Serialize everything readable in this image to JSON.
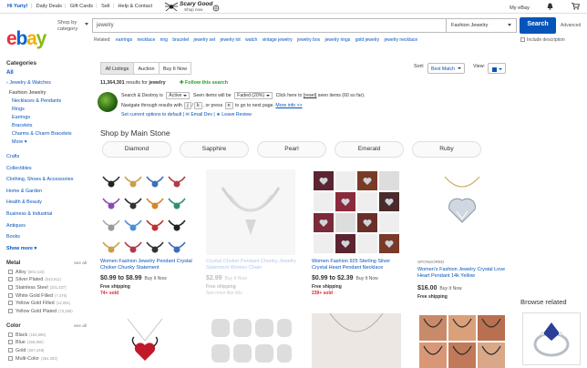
{
  "topbar": {
    "greeting": "Hi Yuriy!",
    "links": [
      "Daily Deals",
      "Gift Cards",
      "Sell",
      "Help & Contact"
    ],
    "promo_line1": "Scary Good",
    "promo_line2": "Shop now",
    "my_ebay": "My eBay",
    "icons": [
      "bell-icon",
      "cart-icon"
    ]
  },
  "header": {
    "logo_letters": [
      "e",
      "b",
      "a",
      "y"
    ],
    "logo_colors": [
      "#e53238",
      "#0064d2",
      "#f5af02",
      "#86b817"
    ],
    "shop_by_category": "Shop by category",
    "search_value": "jewelry",
    "category_value": "Fashion Jewelry",
    "search_button": "Search",
    "advanced": "Advanced",
    "related_label": "Related:",
    "related": [
      "earrings",
      "necklace",
      "ring",
      "bracelet",
      "jewelry set",
      "jewelry lot",
      "watch",
      "vintage jewelry",
      "jewelry box",
      "jewelry rings",
      "gold jewelry",
      "jewelry necklace"
    ],
    "include_description": "Include description"
  },
  "sidebar": {
    "heading": "Categories",
    "all": "All",
    "crumb": "‹ Jewelry & Watches",
    "current": "Fashion Jewelry",
    "subs": [
      "Necklaces & Pendants",
      "Rings",
      "Earrings",
      "Bracelets",
      "Charms & Charm Bracelets"
    ],
    "subs_more": "More ▾",
    "top_cats": [
      "Crafts",
      "Collectibles",
      "Clothing, Shoes & Accessories",
      "Home & Garden",
      "Health & Beauty",
      "Business & Industrial",
      "Antiques",
      "Books"
    ],
    "show_more": "Show more ▾",
    "facets": [
      {
        "title": "Metal",
        "see_all": "see all",
        "options": [
          {
            "label": "Alloy",
            "count": "(604,143)"
          },
          {
            "label": "Silver Plated",
            "count": "(543,911)"
          },
          {
            "label": "Stainless Steel",
            "count": "(201,437)"
          },
          {
            "label": "White Gold Filled",
            "count": "(7,476)"
          },
          {
            "label": "Yellow Gold Filled",
            "count": "(12,081)"
          },
          {
            "label": "Yellow Gold Plated",
            "count": "(73,359)"
          }
        ]
      },
      {
        "title": "Color",
        "see_all": "see all",
        "options": [
          {
            "label": "Black",
            "count": "(183,596)"
          },
          {
            "label": "Blue",
            "count": "(169,960)"
          },
          {
            "label": "Gold",
            "count": "(287,246)"
          },
          {
            "label": "Multi-Color",
            "count": "(254,203)"
          }
        ]
      }
    ]
  },
  "listing": {
    "tabs": [
      "All Listings",
      "Auction",
      "Buy It Now"
    ],
    "sort_label": "Sort:",
    "sort_value": "Best Match",
    "view_label": "View:",
    "results_count": "11,364,301",
    "results_text": "results for",
    "results_query": "jewelry",
    "follow": "Follow this search",
    "ext_line1_a": "Search & Destroy is",
    "ext_line1_active": "Active",
    "ext_line1_b": "Seen items will be",
    "ext_line1_faded": "Faded (20%)",
    "ext_line1_c": "Click here to",
    "ext_line1_reset": "[reset]",
    "ext_line1_d": "seen items (60 so far).",
    "ext_line2_a": "Navigate through results with",
    "ext_key_j": "j",
    "ext_key_k": "k",
    "ext_line2_b": ", or press",
    "ext_key_n": "n",
    "ext_line2_c": "to go to next page.",
    "ext_more": "More info >>",
    "ext_line3": "Set current options to default | ✉ Email Dev | ★ Leave Review",
    "shop_by": "Shop by Main Stone",
    "stones": [
      "Diamond",
      "Sapphire",
      "Pearl",
      "Emerald",
      "Ruby"
    ]
  },
  "cards": [
    {
      "title": "Women Fashion Jewelry Pendant Crystal Choker Chunky Statement",
      "price": "$0.99 to $8.99",
      "bin": "Buy It Now",
      "shipping": "Free shipping",
      "sold": "74+ sold",
      "faded": false
    },
    {
      "title": "Crystal Choker Pendant Chunky Jewelry Statement Women Chain",
      "price": "$2.99",
      "bin": "Buy It Now",
      "shipping": "Free shipping",
      "sold": "See more like this",
      "faded": true
    },
    {
      "title": "Women Fashion 925 Sterling Silver Crystal Heart Pendant Necklace",
      "price": "$0.99 to $2.39",
      "bin": "Buy It Now",
      "shipping": "Free shipping",
      "sold": "239+ sold",
      "faded": false
    },
    {
      "sponsored": "SPONSORED",
      "title": "Women's Fashion Jewelry Crystal Love Heart Pendant 14k Yellow",
      "price": "$16.00",
      "bin": "Buy It Now",
      "shipping": "Free shipping",
      "sold": "",
      "faded": false
    }
  ],
  "browse_related": "Browse related"
}
